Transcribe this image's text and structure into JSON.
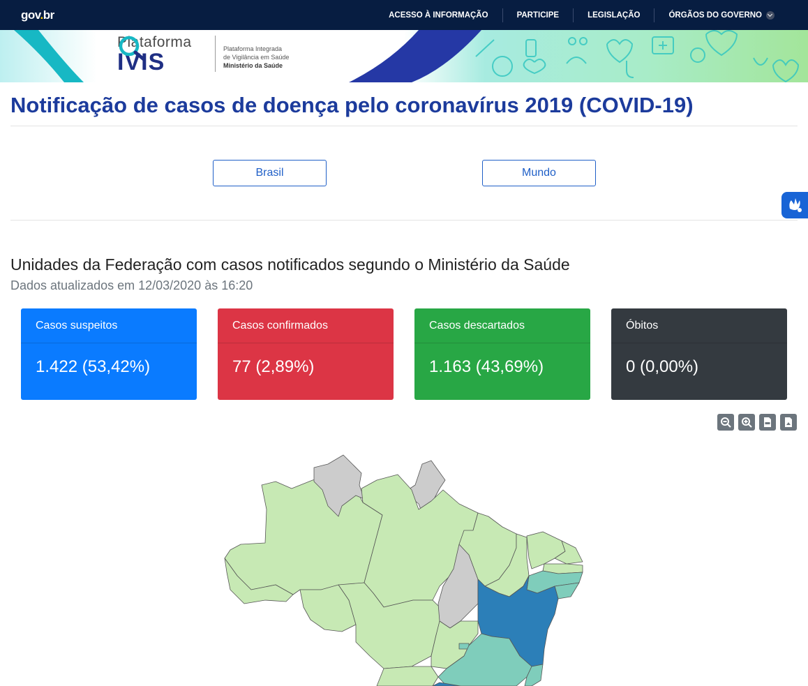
{
  "govbar": {
    "logo_main": "gov",
    "logo_dot": ".",
    "logo_end": "br",
    "nav": [
      "ACESSO À INFORMAÇÃO",
      "PARTICIPE",
      "LEGISLAÇÃO",
      "ÓRGÃOS DO GOVERNO"
    ]
  },
  "banner": {
    "brand_top": "Plataforma",
    "brand_main": "IVIS",
    "sub_line1": "Plataforma Integrada",
    "sub_line2": "de Vigilância em Saúde",
    "sub_line3": "Ministério da Saúde"
  },
  "page": {
    "title": "Notificação de casos de doença pelo coronavírus 2019 (COVID-19)",
    "btn_brasil": "Brasil",
    "btn_mundo": "Mundo",
    "subtitle": "Unidades da Federação com casos notificados segundo o Ministério da Saúde",
    "updated": "Dados atualizados em 12/03/2020 às 16:20"
  },
  "cards": [
    {
      "label": "Casos suspeitos",
      "value": "1.422 (53,42%)",
      "color": "#0a7bff"
    },
    {
      "label": "Casos confirmados",
      "value": "77 (2,89%)",
      "color": "#dc3545"
    },
    {
      "label": "Casos descartados",
      "value": "1.163 (43,69%)",
      "color": "#28a745"
    },
    {
      "label": "Óbitos",
      "value": "0 (0,00%)",
      "color": "#343a40"
    }
  ],
  "tools": [
    "zoom-out-icon",
    "zoom-in-icon",
    "csv-icon",
    "image-export-icon"
  ],
  "map_colors": {
    "light_green": "#c7e9b4",
    "grey": "#cccccc",
    "teal": "#7fcdbb",
    "blue": "#2c7fb8"
  }
}
